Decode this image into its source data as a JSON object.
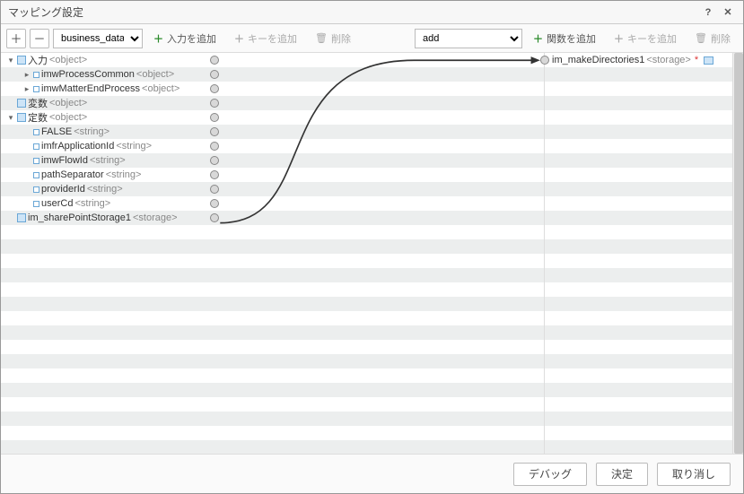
{
  "title": "マッピング設定",
  "toolbar": {
    "select_left_value": "business_data_set",
    "add_input": "入力を追加",
    "add_key": "キーを追加",
    "delete": "削除",
    "select_right_value": "add",
    "select_right_options": [
      "add"
    ],
    "add_func": "関数を追加"
  },
  "left_tree": [
    {
      "indent": 0,
      "toggle": "down",
      "icon": "sq-fill",
      "name": "入力",
      "type": "<object>"
    },
    {
      "indent": 1,
      "toggle": "right",
      "icon": "tiny",
      "name": "imwProcessCommon",
      "type": "<object>"
    },
    {
      "indent": 1,
      "toggle": "right",
      "icon": "tiny",
      "name": "imwMatterEndProcess",
      "type": "<object>"
    },
    {
      "indent": 0,
      "toggle": "none",
      "icon": "sq-fill",
      "name": "変数",
      "type": "<object>"
    },
    {
      "indent": 0,
      "toggle": "down",
      "icon": "sq-fill",
      "name": "定数",
      "type": "<object>"
    },
    {
      "indent": 1,
      "toggle": "none",
      "icon": "tiny",
      "name": "FALSE",
      "type": "<string>"
    },
    {
      "indent": 1,
      "toggle": "none",
      "icon": "tiny",
      "name": "imfrApplicationId",
      "type": "<string>"
    },
    {
      "indent": 1,
      "toggle": "none",
      "icon": "tiny",
      "name": "imwFlowId",
      "type": "<string>"
    },
    {
      "indent": 1,
      "toggle": "none",
      "icon": "tiny",
      "name": "pathSeparator",
      "type": "<string>"
    },
    {
      "indent": 1,
      "toggle": "none",
      "icon": "tiny",
      "name": "providerId",
      "type": "<string>"
    },
    {
      "indent": 1,
      "toggle": "none",
      "icon": "tiny",
      "name": "userCd",
      "type": "<string>"
    },
    {
      "indent": 0,
      "toggle": "none",
      "icon": "sq-fill",
      "name": "im_sharePointStorage1",
      "type": "<storage>"
    }
  ],
  "right_tree": [
    {
      "name": "im_makeDirectories1",
      "type": "<storage>",
      "required": true
    }
  ],
  "footer": {
    "debug": "デバッグ",
    "ok": "決定",
    "cancel": "取り消し"
  }
}
